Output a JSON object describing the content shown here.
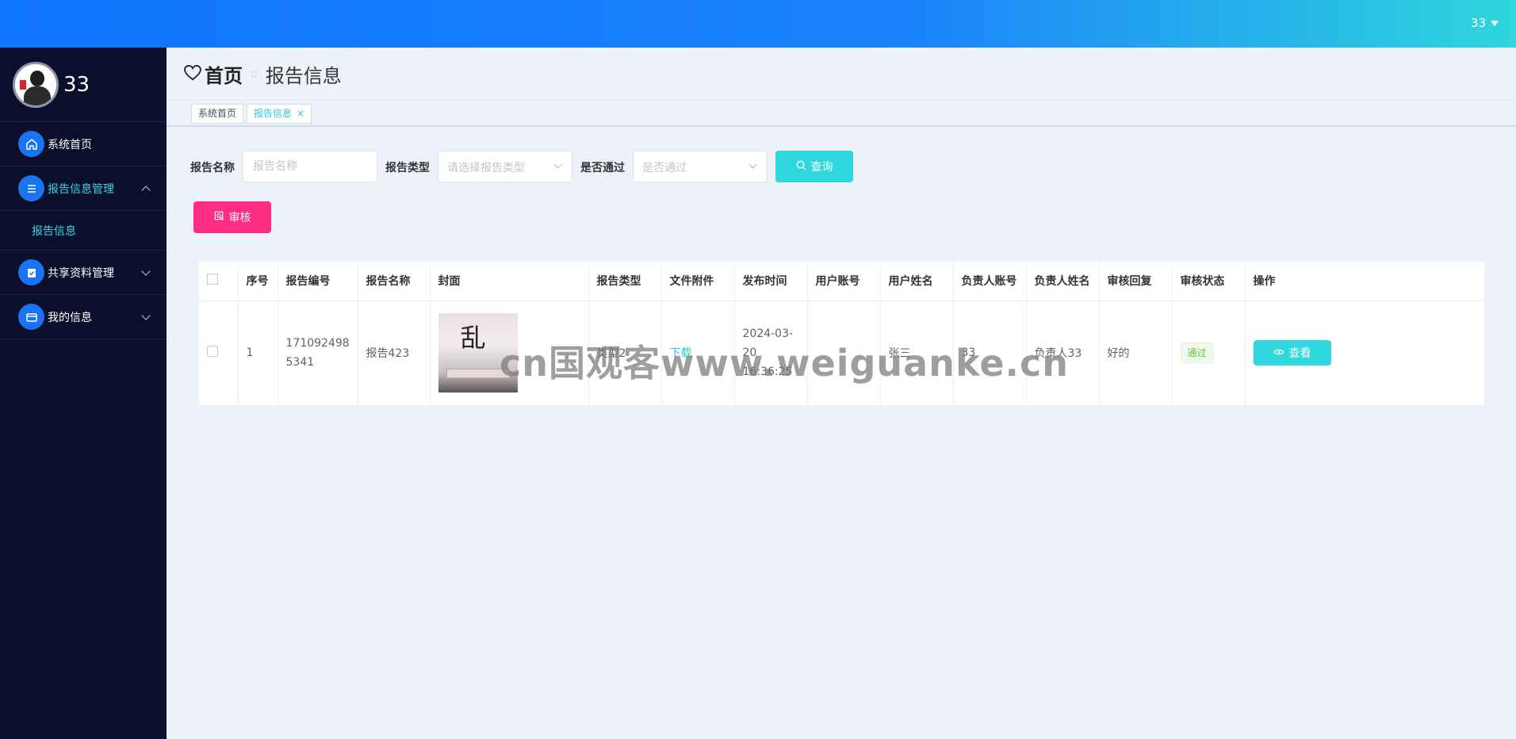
{
  "top": {
    "user": "33"
  },
  "sidebar": {
    "profile_name": "33",
    "items": [
      {
        "label": "系统首页"
      },
      {
        "label": "报告信息管理"
      },
      {
        "label": "共享资料管理"
      },
      {
        "label": "我的信息"
      }
    ],
    "submenu": [
      {
        "label": "报告信息"
      }
    ]
  },
  "header": {
    "home": "首页",
    "separator": "::",
    "current": "报告信息"
  },
  "tabs": [
    {
      "label": "系统首页"
    },
    {
      "label": "报告信息",
      "close": "×"
    }
  ],
  "search": {
    "name_label": "报告名称",
    "name_placeholder": "报告名称",
    "type_label": "报告类型",
    "type_placeholder": "请选择报告类型",
    "pass_label": "是否通过",
    "pass_placeholder": "是否通过",
    "query_button": "查询"
  },
  "actions": {
    "audit_button": "审核"
  },
  "table": {
    "headers": [
      "序号",
      "报告编号",
      "报告名称",
      "封面",
      "报告类型",
      "文件附件",
      "发布时间",
      "用户账号",
      "用户姓名",
      "负责人账号",
      "负责人姓名",
      "审核回复",
      "审核状态",
      "操作"
    ],
    "rows": [
      {
        "index": "1",
        "report_no": "1710924985341",
        "report_name": "报告423",
        "report_type": "类型2",
        "file": "下载",
        "publish_time": "2024-03-20 16:36:25",
        "user_account": "",
        "user_name": "张三",
        "owner_account": "33",
        "owner_name": "负责人33",
        "reply": "好的",
        "status": "通过",
        "view_button": "查看"
      }
    ]
  },
  "watermark": "cn国观客www.weiguanke.cn",
  "colors": {
    "accent": "#2fd8dc",
    "danger": "#ff2c83",
    "sidebar": "#0b0f2b",
    "primary": "#1a73f0"
  }
}
